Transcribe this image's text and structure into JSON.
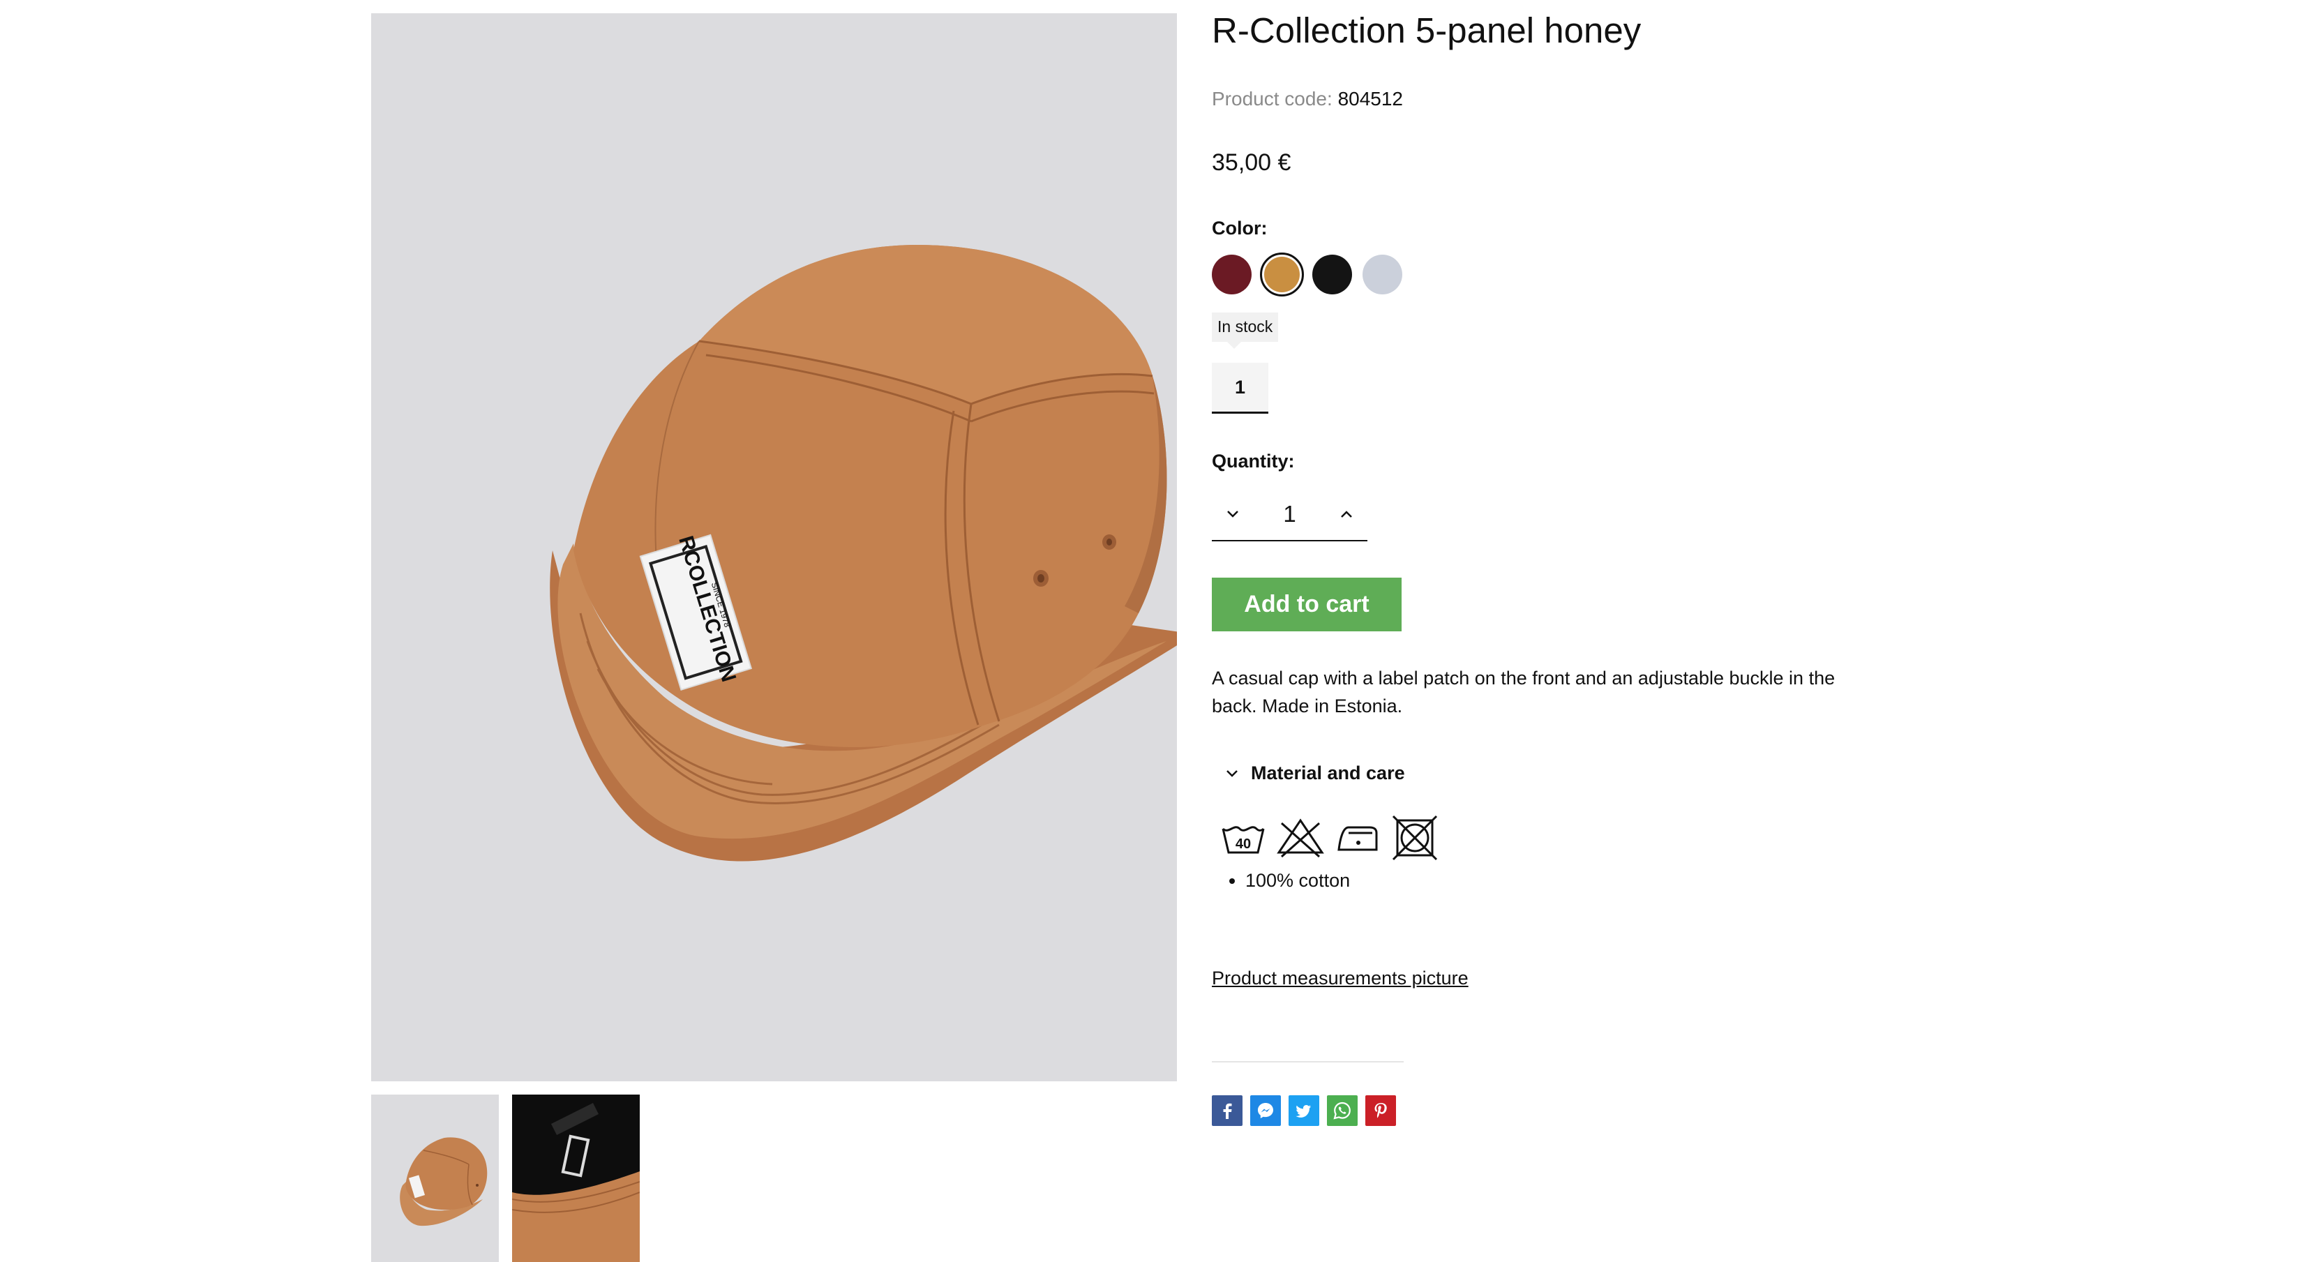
{
  "product": {
    "title": "R-Collection 5-panel honey",
    "code_label": "Product code:",
    "code_value": "804512",
    "price": "35,00 €",
    "color_label": "Color:",
    "colors": [
      {
        "name": "burgundy",
        "hex": "#6b1a24"
      },
      {
        "name": "honey",
        "hex": "#c98f41",
        "selected": true
      },
      {
        "name": "black",
        "hex": "#141414"
      },
      {
        "name": "light-grey",
        "hex": "#cbd0db"
      }
    ],
    "stock_label": "In stock",
    "variant_value": "1",
    "quantity_label": "Quantity:",
    "quantity_value": "1",
    "add_to_cart": "Add to cart",
    "description": "A casual cap with a label patch on the front and an adjustable buckle in the back. Made in Estonia.",
    "material_title": "Material and care",
    "care_icons": [
      "wash-40-icon",
      "no-bleach-icon",
      "iron-low-icon",
      "no-tumble-dry-icon"
    ],
    "care_wash_temp": "40",
    "materials": [
      "100% cotton"
    ],
    "measurements_link": "Product measurements picture",
    "patch_text": "RCOLLECTION",
    "patch_subtext": "SINCE 1978"
  },
  "share": [
    {
      "name": "facebook-icon",
      "color": "#3b5998"
    },
    {
      "name": "messenger-icon",
      "color": "#1e88e5"
    },
    {
      "name": "twitter-icon",
      "color": "#1da1f2"
    },
    {
      "name": "whatsapp-icon",
      "color": "#4caf50"
    },
    {
      "name": "pinterest-icon",
      "color": "#cb2027"
    }
  ],
  "colors": {
    "accent_green": "#5fad56",
    "image_background": "#dcdcdf",
    "cap": "#c4814f"
  }
}
